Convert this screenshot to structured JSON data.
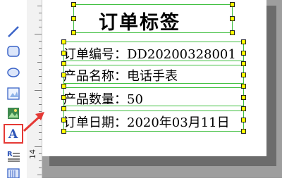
{
  "label": {
    "title": "订单标签",
    "lines": [
      "订单编号：DD20200328001",
      "产品名称：电话手表",
      "产品数量：50",
      "订单日期：2020年03月11日"
    ]
  },
  "ruler": {
    "visible_number": "14"
  },
  "colors": {
    "selection_line": "#3fbf3f",
    "handle_fill": "#ffff00",
    "highlight": "#e53935",
    "canvas_bg": "#9e9e9e"
  },
  "toolbar": {
    "tools": [
      "line-tool-icon",
      "rounded-rectangle-tool-icon",
      "ellipse-tool-icon",
      "image-tool-icon",
      "picture-tool-icon",
      "text-tool-icon",
      "rich-text-tool-icon",
      "barcode-tool-icon"
    ],
    "selected": "text-tool-icon"
  }
}
